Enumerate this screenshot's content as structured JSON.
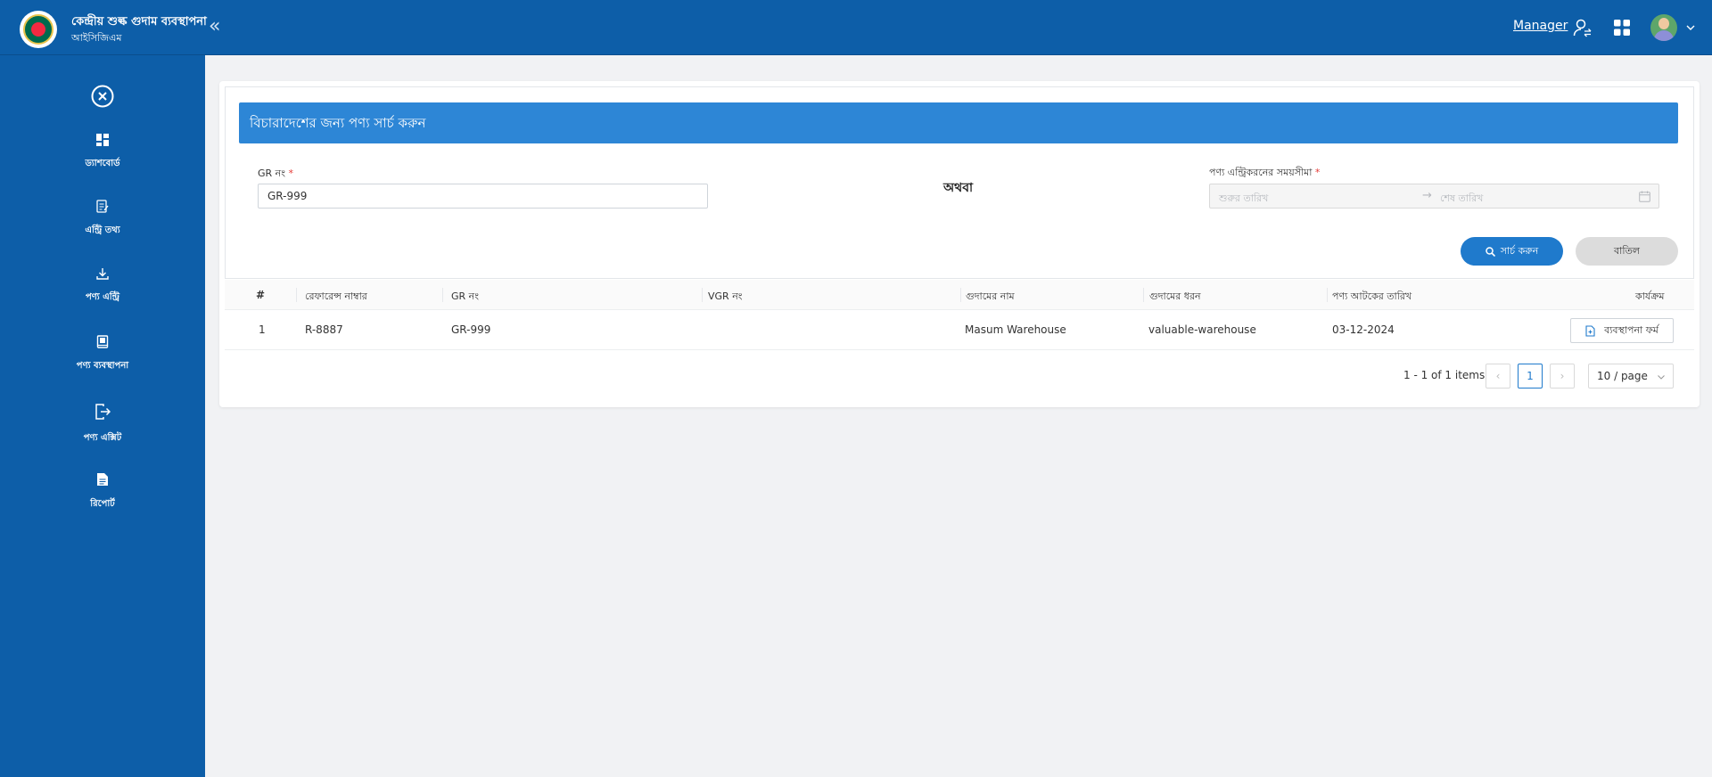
{
  "header": {
    "brand_title": "কেন্দ্রীয় শুল্ক গুদাম ব্যবস্থাপনা",
    "brand_subtitle": "আইসিজিএম",
    "collapse_glyph": "«",
    "role_label": "Manager"
  },
  "sidebar": {
    "items": [
      {
        "label": "ড্যাশবোর্ড",
        "icon": "dashboard-icon"
      },
      {
        "label": "এন্ট্রি তথ্য",
        "icon": "entry-info-icon"
      },
      {
        "label": "পণ্য এন্ট্রি",
        "icon": "download-icon"
      },
      {
        "label": "পণ্য ব্যবস্থাপনা",
        "icon": "book-icon"
      },
      {
        "label": "পণ্য এক্সিট",
        "icon": "exit-icon"
      },
      {
        "label": "রিপোর্ট",
        "icon": "report-icon"
      }
    ]
  },
  "search": {
    "title": "বিচারাদেশের জন্য পণ্য সার্চ করুন",
    "gr_label": "GR নং",
    "required_mark": "*",
    "gr_value": "GR-999",
    "or_text": "অথবা",
    "date_label": "পণ্য এন্ট্রিকরনের সময়সীমা",
    "date_start_placeholder": "শুরুর তারিখ",
    "date_arrow": "→",
    "date_end_placeholder": "শেষ তারিখ",
    "search_button": "সার্চ করুন",
    "cancel_button": "বাতিল"
  },
  "table": {
    "columns": [
      "#",
      "রেফারেন্স নাম্বার",
      "GR নং",
      "VGR নং",
      "গুদামের নাম",
      "গুদামের ধরন",
      "পণ্য আটকের তারিখ",
      "কার্যক্রম"
    ],
    "rows": [
      {
        "index": "1",
        "reference": "R-8887",
        "gr": "GR-999",
        "vgr": "",
        "warehouse_name": "Masum Warehouse",
        "warehouse_type": "valuable-warehouse",
        "seizure_date": "03-12-2024",
        "action": "ব্যবস্থাপনা ফর্ম"
      }
    ]
  },
  "pagination": {
    "total_text": "1 - 1 of 1 items",
    "prev": "‹",
    "current_page": "1",
    "next": "›",
    "page_size": "10 / page"
  },
  "colors": {
    "brand_blue": "#0d5ea8",
    "header_blue": "#2d86d6",
    "button_blue": "#1f7acc",
    "required_red": "#e53935"
  }
}
